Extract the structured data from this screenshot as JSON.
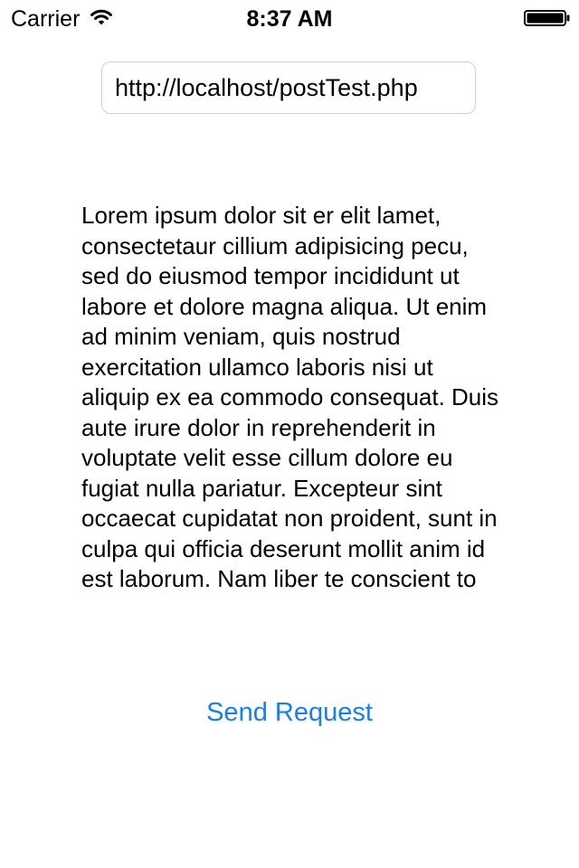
{
  "status_bar": {
    "carrier": "Carrier",
    "time": "8:37 AM",
    "wifi_icon": "wifi-icon",
    "battery_icon": "battery-icon"
  },
  "url_field": {
    "value": "http://localhost/postTest.php"
  },
  "text_view": {
    "content": "Lorem ipsum dolor sit er elit lamet, consectetaur cillium adipisicing pecu, sed do eiusmod tempor incididunt ut labore et dolore magna aliqua. Ut enim ad minim veniam, quis nostrud exercitation ullamco laboris nisi ut aliquip ex ea commodo consequat. Duis aute irure dolor in reprehenderit in voluptate velit esse cillum dolore eu fugiat nulla pariatur. Excepteur sint occaecat cupidatat non proident, sunt in culpa qui officia deserunt mollit anim id est laborum. Nam liber te conscient to"
  },
  "send_button": {
    "label": "Send Request"
  },
  "colors": {
    "accent": "#147efb",
    "text": "#000000",
    "field_border": "#cfcfcf"
  }
}
